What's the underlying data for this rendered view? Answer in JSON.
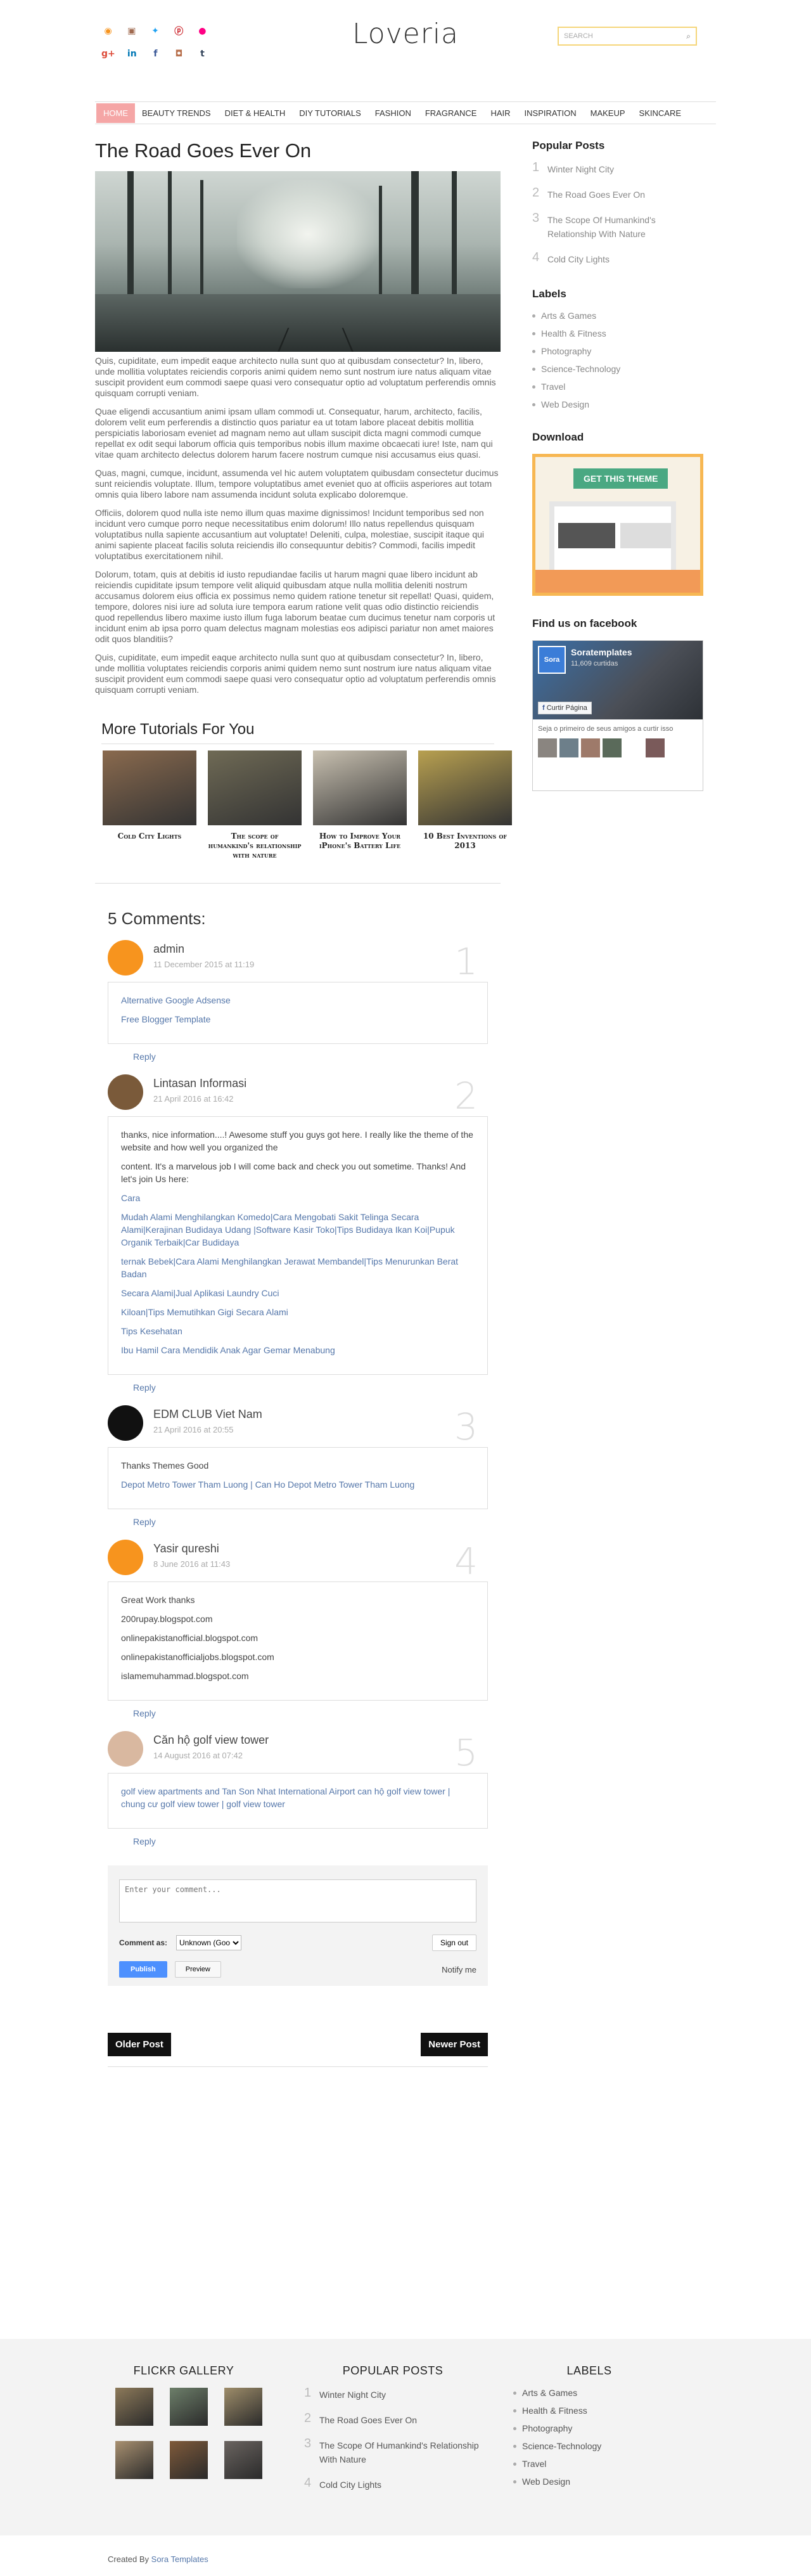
{
  "site": {
    "title": "Loveria"
  },
  "search": {
    "placeholder": "SEARCH"
  },
  "nav": {
    "items": [
      "HOME",
      "BEAUTY TRENDS",
      "DIET & HEALTH",
      "DIY TUTORIALS",
      "FASHION",
      "FRAGRANCE",
      "HAIR",
      "INSPIRATION",
      "MAKEUP",
      "SKINCARE"
    ]
  },
  "post": {
    "title": "The Road Goes Ever On",
    "paragraphs": [
      "Quis, cupiditate, eum impedit eaque architecto nulla sunt quo at quibusdam consectetur? In, libero, unde mollitia voluptates reiciendis corporis animi quidem nemo sunt nostrum iure natus aliquam vitae suscipit provident eum commodi saepe quasi vero consequatur optio ad voluptatum perferendis omnis quisquam corrupti veniam.",
      "Quae eligendi accusantium animi ipsam ullam commodi ut. Consequatur, harum, architecto, facilis, dolorem velit eum perferendis a distinctio quos pariatur ea ut totam labore placeat debitis mollitia perspiciatis laboriosam eveniet ad magnam nemo aut ullam suscipit dicta magni commodi cumque repellat ex odit sequi laborum officia quis temporibus nobis illum maxime obcaecati iure! Iste, nam qui vitae quam architecto delectus dolorem harum facere nostrum cumque nisi accusamus eius quasi.",
      "Quas, magni, cumque, incidunt, assumenda vel hic autem voluptatem quibusdam consectetur ducimus sunt reiciendis voluptate. Illum, tempore voluptatibus amet eveniet quo at officiis asperiores aut totam omnis quia libero labore nam assumenda incidunt soluta explicabo doloremque.",
      "Officiis, dolorem quod nulla iste nemo illum quas maxime dignissimos! Incidunt temporibus sed non incidunt vero cumque porro neque necessitatibus enim dolorum! Illo natus repellendus quisquam voluptatibus nulla sapiente accusantium aut voluptate! Deleniti, culpa, molestiae, suscipit itaque qui animi sapiente placeat facilis soluta reiciendis illo consequuntur debitis? Commodi, facilis impedit voluptatibus exercitationem nihil.",
      "Dolorum, totam, quis at debitis id iusto repudiandae facilis ut harum magni quae libero incidunt ab reiciendis cupiditate ipsum tempore velit aliquid quibusdam atque nulla mollitia deleniti nostrum accusamus dolorem eius officia ex possimus nemo quidem ratione tenetur sit repellat! Quasi, quidem, tempore, dolores nisi iure ad soluta iure tempora earum ratione velit quas odio distinctio reiciendis quod repellendus libero maxime iusto illum fuga laborum beatae cum ducimus tenetur nam corporis ut incidunt enim ab ipsa porro quam delectus magnam molestias eos adipisci pariatur non amet maiores odit quos blanditiis?",
      "Quis, cupiditate, eum impedit eaque architecto nulla sunt quo at quibusdam consectetur? In, libero, unde mollitia voluptates reiciendis corporis animi quidem nemo sunt nostrum iure natus aliquam vitae suscipit provident eum commodi saepe quasi vero consequatur optio ad voluptatum perferendis omnis quisquam corrupti veniam."
    ]
  },
  "related": {
    "heading": "More Tutorials For You",
    "items": [
      {
        "title": "Cold City Lights",
        "color": "#8a6a4e"
      },
      {
        "title": "The scope of humankind's relationship with nature",
        "color": "#6f6a55"
      },
      {
        "title": "How to Improve Your iPhone's Battery Life",
        "color": "#c8c0b0"
      },
      {
        "title": "10 Best Inventions of 2013",
        "color": "#b8a050"
      }
    ]
  },
  "comments": {
    "heading": "5 Comments:",
    "reply_label": "Reply",
    "items": [
      {
        "author": "admin",
        "date": "11 December 2015 at 11:19",
        "num": "1",
        "avatar_color": "#f7941e",
        "lines": [
          "Alternative Google Adsense",
          "Free Blogger Template"
        ]
      },
      {
        "author": "Lintasan Informasi",
        "date": "21 April 2016 at 16:42",
        "num": "2",
        "avatar_color": "#7a5a3a",
        "lines": [
          "thanks, nice information....! Awesome stuff you guys got here. I really like the theme of the website and how well you organized the",
          "content. It's a marvelous job I will come back and check you out sometime. Thanks! And let's join Us here:",
          "Cara",
          "Mudah Alami Menghilangkan Komedo|Cara Mengobati Sakit Telinga Secara Alami|Kerajinan Budidaya Udang |Software Kasir Toko|Tips Budidaya Ikan Koi|Pupuk Organik Terbaik|Car Budidaya",
          "ternak Bebek|Cara Alami Menghilangkan Jerawat Membandel|Tips Menurunkan Berat Badan",
          "Secara Alami|Jual Aplikasi Laundry Cuci",
          "Kiloan|Tips Memutihkan Gigi Secara Alami",
          "Tips Kesehatan",
          "Ibu Hamil Cara Mendidik Anak Agar Gemar Menabung"
        ]
      },
      {
        "author": "EDM CLUB Viet Nam",
        "date": "21 April 2016 at 20:55",
        "num": "3",
        "avatar_color": "#111111",
        "lines": [
          "Thanks Themes Good",
          "Depot Metro Tower Tham Luong | Can Ho Depot Metro Tower Tham Luong"
        ]
      },
      {
        "author": "Yasir qureshi",
        "date": "8 June 2016 at 11:43",
        "num": "4",
        "avatar_color": "#f7941e",
        "lines": [
          "Great Work thanks",
          "200rupay.blogspot.com",
          "onlinepakistanofficial.blogspot.com",
          "onlinepakistanofficialjobs.blogspot.com",
          "islamemuhammad.blogspot.com"
        ]
      },
      {
        "author": "Căn hộ golf view tower",
        "date": "14 August 2016 at 07:42",
        "num": "5",
        "avatar_color": "#d9b8a0",
        "lines": [
          "golf view apartments and Tan Son Nhat International Airport can hộ golf view tower | chung cư golf view tower | golf view tower"
        ]
      }
    ]
  },
  "comment_form": {
    "placeholder": "Enter your comment...",
    "comment_as": "Comment as:",
    "select_value": "Unknown (Goo",
    "sign_out": "Sign out",
    "publish": "Publish",
    "preview": "Preview",
    "notify": "Notify me"
  },
  "pager": {
    "older": "Older Post",
    "newer": "Newer Post"
  },
  "sidebar": {
    "popular_heading": "Popular Posts",
    "popular": [
      {
        "n": "1",
        "title": "Winter Night City"
      },
      {
        "n": "2",
        "title": "The Road Goes Ever On"
      },
      {
        "n": "3",
        "title": "The Scope Of Humankind's Relationship With Nature"
      },
      {
        "n": "4",
        "title": "Cold City Lights"
      }
    ],
    "labels_heading": "Labels",
    "labels": [
      "Arts & Games",
      "Health & Fitness",
      "Photography",
      "Science-Technology",
      "Travel",
      "Web Design"
    ],
    "download_heading": "Download",
    "download_ribbon": "GET THIS THEME",
    "facebook_heading": "Find us on facebook",
    "fb_name": "Soratemplates",
    "fb_likes": "11,609 curtidas",
    "fb_like": "Curtir Página",
    "fb_text": "Seja o primeiro de seus amigos a curtir isso",
    "fb_logo": "Sora"
  },
  "footer": {
    "flickr_heading": "FLICKR GALLERY",
    "flickr_colors": [
      "#8d7a5a",
      "#6d7f6a",
      "#9e8d6a",
      "#a89070",
      "#7f5a3a",
      "#6a6460"
    ],
    "popular_heading": "POPULAR POSTS",
    "labels_heading": "LABELS",
    "credit_prefix": "Created By ",
    "credit_link": "Sora Templates"
  },
  "colors": {
    "accent": "#f5a6a6",
    "link": "#5577aa",
    "download_border": "#f7b752"
  }
}
